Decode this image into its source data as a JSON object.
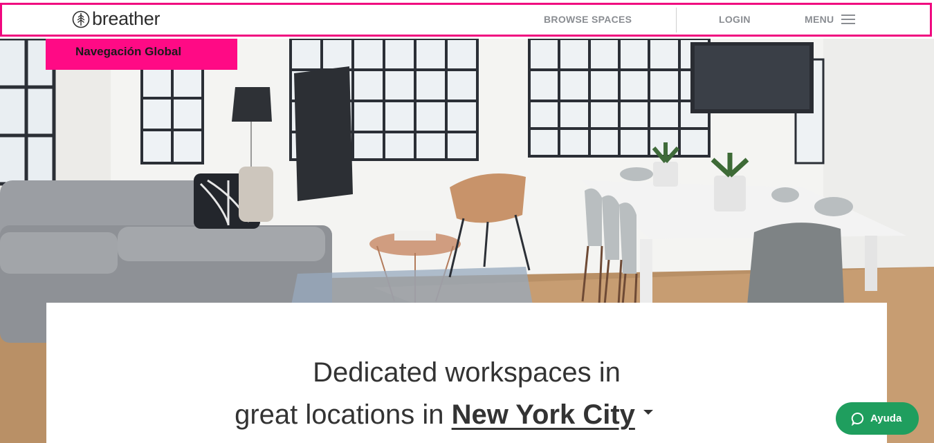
{
  "header": {
    "logo_text": "breather",
    "nav": {
      "browse_spaces": "BROWSE SPACES",
      "login": "LOGIN",
      "menu": "MENU"
    }
  },
  "annotation": {
    "label": "Navegación Global",
    "color": "#f0077f"
  },
  "hero": {
    "headline_line1": "Dedicated workspaces in",
    "headline_line2_prefix": "great locations in",
    "city": "New York City"
  },
  "help_button": {
    "label": "Ayuda",
    "color": "#1f9e5e"
  },
  "icons": {
    "logo": "tree-circle-icon",
    "menu": "hamburger-icon",
    "city_dropdown": "caret-down-icon",
    "help": "chat-bubble-icon"
  }
}
